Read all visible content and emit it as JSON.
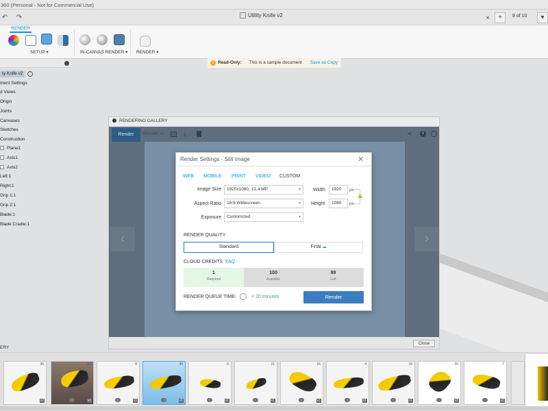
{
  "app": {
    "title_bar": "360 (Personal - Not for Commercial Use)",
    "document_tab": "Utility Knife v2",
    "pager": "8 of 10"
  },
  "toolbar": {
    "active_tab": "RENDER",
    "groups": [
      {
        "label": "SETUP ▾"
      },
      {
        "label": "IN-CANVAS RENDER ▾"
      },
      {
        "label": "RENDER ▾"
      }
    ]
  },
  "readonly_bar": {
    "label": "Read-Only:",
    "message": "This is a sample document",
    "action": "Save as Copy"
  },
  "browser": {
    "root": "ty Knife v2",
    "items": [
      "ment Settings",
      "d Views",
      "Origin",
      "Joints",
      "Canvases",
      "Sketches",
      "Construction",
      "Plane1",
      "Axis1",
      "Axis2",
      "Left:1",
      "Right:1",
      "Grip 1:1",
      "Grip 2:1",
      "Blade:1",
      "Blade Cradle:1"
    ]
  },
  "gallery": {
    "title": "RENDERING GALLERY",
    "render_button": "Render",
    "render_in": "Render in",
    "close": "Close"
  },
  "dialog": {
    "title": "Render Settings - Still Image",
    "tabs": [
      "WEB",
      "MOBILE",
      "PRINT",
      "VIDEO",
      "CUSTOM"
    ],
    "image_size_label": "Image Size",
    "image_size_value": "1920x1080, 12.4 MP",
    "aspect_label": "Aspect Ratio",
    "aspect_value": "16:9 Widescreen",
    "exposure_label": "Exposure",
    "exposure_value": "Customized",
    "width_label": "Width",
    "width_value": "1920",
    "height_label": "Height",
    "height_value": "1080",
    "unit": "px",
    "quality_label": "RENDER QUALITY",
    "quality_standard": "Standard",
    "quality_final": "Final",
    "credits_label": "CLOUD CREDITS",
    "faq": "FAQ",
    "credits": [
      {
        "value": "1",
        "label": "Required"
      },
      {
        "value": "100",
        "label": "Available"
      },
      {
        "value": "99",
        "label": "Left"
      }
    ],
    "queue_label": "RENDER QUEUE TIME:",
    "queue_value": "< 20 minutes",
    "render_button": "Render"
  },
  "film": {
    "label": "ERY",
    "thumbs": [
      {
        "count": "36",
        "version": "v2"
      },
      {
        "count": "62",
        "version": "v2"
      },
      {
        "count": "8",
        "version": "v1"
      },
      {
        "count": "40",
        "version": "v1"
      },
      {
        "count": "6",
        "version": "v1"
      },
      {
        "count": "21",
        "version": "v1"
      },
      {
        "count": "16",
        "version": "v1"
      },
      {
        "count": "4",
        "version": "v1"
      },
      {
        "count": "15",
        "version": "v1"
      },
      {
        "count": "20",
        "version": "v2"
      },
      {
        "count": "7",
        "version": "v2"
      }
    ]
  },
  "colors": {
    "accent": "#0696d7",
    "render_button": "#3c7cc0",
    "gallery_bg": "#5f6e7d",
    "queue_green": "#3aa668"
  }
}
